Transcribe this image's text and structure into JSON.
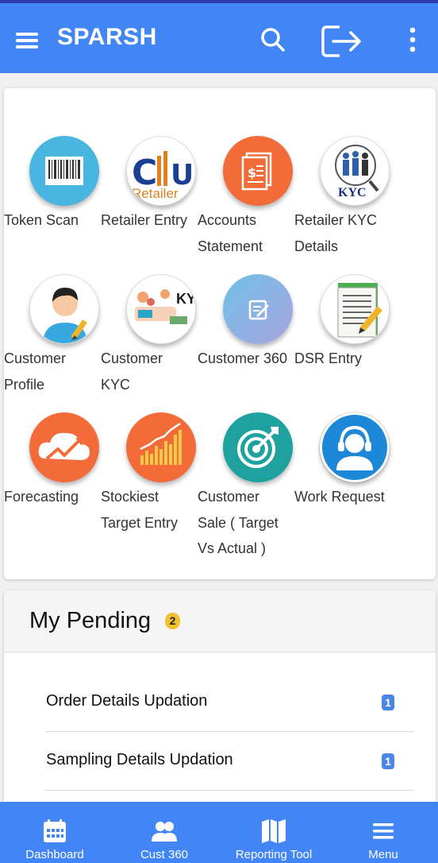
{
  "app": {
    "title": "SPARSH",
    "colors": {
      "primary": "#4285f4",
      "badge_yellow": "#f2c12e",
      "badge_blue": "#4a86e8"
    }
  },
  "header_icons": [
    "hamburger-menu-icon",
    "search-icon",
    "logout-icon",
    "more-vertical-icon"
  ],
  "tiles": [
    {
      "label": "Token Scan",
      "icon": "barcode-icon"
    },
    {
      "label": "Retailer Entry",
      "icon": "retailer-logo-icon",
      "icon_text": "Retailer"
    },
    {
      "label": "Accounts Statement",
      "icon": "statement-document-icon"
    },
    {
      "label": "Retailer KYC Details",
      "icon": "kyc-people-icon",
      "icon_text": "KYC"
    },
    {
      "label": "Customer Profile",
      "icon": "customer-avatar-icon"
    },
    {
      "label": "Customer KYC",
      "icon": "customer-kyc-illustration-icon",
      "icon_text": "KY"
    },
    {
      "label": "Customer 360",
      "icon": "edit-note-icon"
    },
    {
      "label": "DSR Entry",
      "icon": "notepad-pencil-icon"
    },
    {
      "label": "Forecasting",
      "icon": "cloud-trend-icon"
    },
    {
      "label": "Stockiest Target Entry",
      "icon": "bar-chart-growth-icon"
    },
    {
      "label": "Customer Sale ( Target Vs Actual )",
      "icon": "target-arrow-icon"
    },
    {
      "label": "Work Request",
      "icon": "support-headset-icon"
    }
  ],
  "pending": {
    "title": "My Pending",
    "badge": "2",
    "items": [
      {
        "label": "Order Details Updation",
        "count": "1"
      },
      {
        "label": "Sampling Details Updation",
        "count": "1"
      }
    ]
  },
  "bottom_nav": [
    {
      "label": "Dashboard",
      "icon": "calendar-icon"
    },
    {
      "label": "Cust 360",
      "icon": "users-icon"
    },
    {
      "label": "Reporting Tool",
      "icon": "map-icon"
    },
    {
      "label": "Menu",
      "icon": "hamburger-icon"
    }
  ]
}
